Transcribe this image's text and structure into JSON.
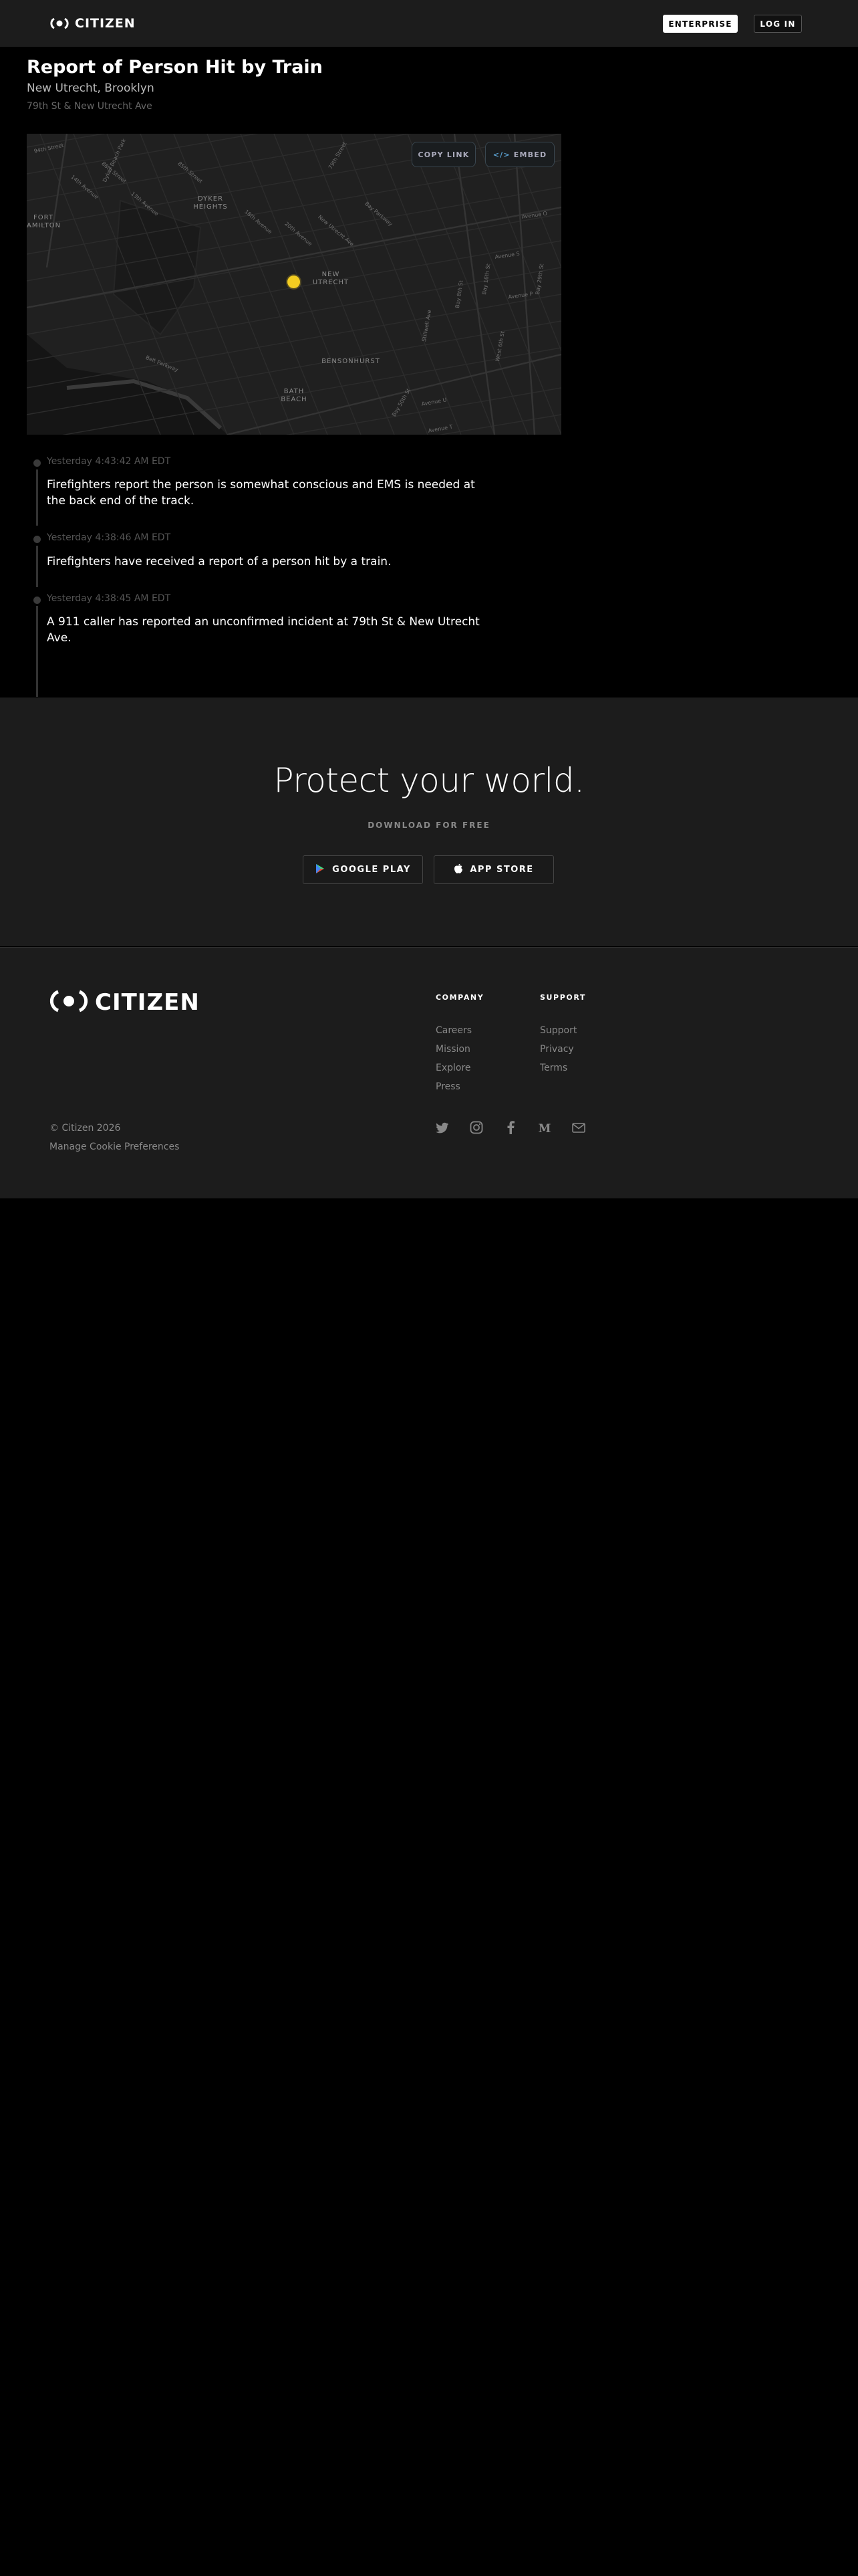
{
  "header": {
    "brand": "CITIZEN",
    "enterprise_label": "ENTERPRISE",
    "login_label": "LOG IN"
  },
  "incident": {
    "title": "Report of Person Hit by Train",
    "neighborhood": "New Utrecht, Brooklyn",
    "address": "79th St & New Utrecht Ave"
  },
  "map": {
    "copy_link_label": "COPY LINK",
    "embed_label": "EMBED",
    "embed_glyph": "</>",
    "pin_color": "#f4cd21",
    "area_labels": {
      "fort_hamilton": "FORT\nAMILTON",
      "dyker_heights": "DYKER\nHEIGHTS",
      "new_utrecht": "NEW\nUTRECHT",
      "bensonhurst": "BENSONHURST",
      "bath_beach": "BATH\nBEACH"
    },
    "streets": [
      "94th Street",
      "88th Street",
      "14th Avenue",
      "Dyker Beach Park",
      "85th Street",
      "13th Avenue",
      "79th Street",
      "18th Avenue",
      "New Utrecht Ave",
      "20th Avenue",
      "Bay Parkway",
      "Belt Parkway",
      "Avenue O",
      "Avenue P",
      "Stillwell Ave",
      "Avenue S",
      "Bay 8th St",
      "Bay 16th St",
      "Bay 29th St",
      "West 6th St",
      "Avenue U",
      "Bay 50th St",
      "Avenue T"
    ]
  },
  "timeline": [
    {
      "time": "Yesterday 4:43:42 AM EDT",
      "text": "Firefighters report the person is somewhat conscious and EMS is needed at the back end of the track."
    },
    {
      "time": "Yesterday 4:38:46 AM EDT",
      "text": "Firefighters have received a report of a person hit by a train."
    },
    {
      "time": "Yesterday 4:38:45 AM EDT",
      "text": "A 911 caller has reported an unconfirmed incident at 79th St & New Utrecht Ave."
    }
  ],
  "promo": {
    "title": "Protect your world.",
    "subtitle": "DOWNLOAD FOR FREE",
    "google_play_label": "GOOGLE PLAY",
    "app_store_label": "APP STORE"
  },
  "footer": {
    "brand": "CITIZEN",
    "company_title": "COMPANY",
    "company_links": [
      "Careers",
      "Mission",
      "Explore",
      "Press"
    ],
    "support_title": "SUPPORT",
    "support_links": [
      "Support",
      "Privacy",
      "Terms"
    ],
    "copyright": "© Citizen 2026",
    "cookie_label": "Manage Cookie Preferences",
    "social_icons": [
      "twitter-icon",
      "instagram-icon",
      "facebook-icon",
      "medium-icon",
      "mail-icon"
    ]
  }
}
